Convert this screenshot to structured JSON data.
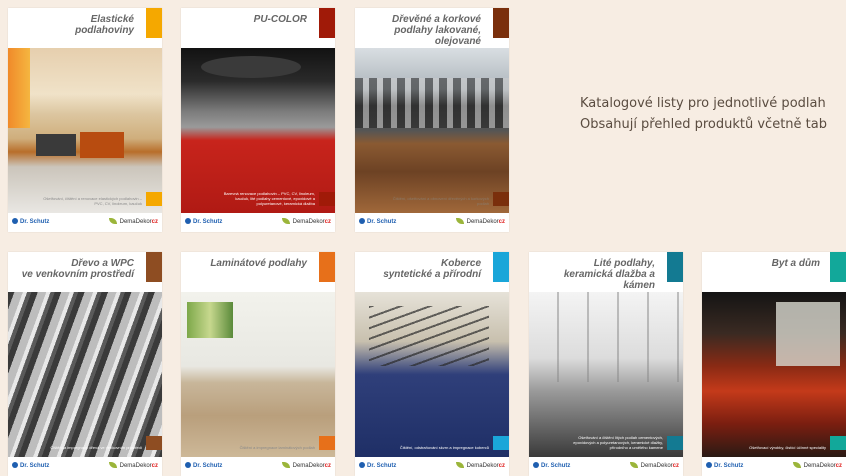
{
  "promo": {
    "line1": "Katalogové listy pro jednotlivé podlah",
    "line2": "Obsahují přehled produktů včetně tab"
  },
  "brand": {
    "left": "Dr. Schutz",
    "right_main": "DemaDekor",
    "right_suffix": "cz"
  },
  "cards": [
    {
      "title": "Elastické\npodlahoviny",
      "accent": "#f5a800",
      "desc": "Ošetřování, čištění a renovace elastických podlahovin – PVC, CV, linoleum, kaučuk",
      "desc_color": "#8a8a8a"
    },
    {
      "title": "PU-COLOR",
      "accent": "#a01a08",
      "desc": "Barevná renovace podlahovin – PVC, CV, linoleum, kaučuk, lité podlahy cementové, epoxidové a polyuretanové, keramická dlažba",
      "desc_color": "#ffffff"
    },
    {
      "title": "Dřevěné a korkové\npodlahy lakované, olejované",
      "accent": "#7a2f0c",
      "desc": "Čištění, ošetřování a obnovení dřevěných a korkových podlah",
      "desc_color": "#8a7a6a"
    },
    {
      "title": "Dřevo a WPC\nve venkovním prostředí",
      "accent": "#8e4d22",
      "desc": "Čištění a impregnace dřeva ve venkovním prostředí",
      "desc_color": "#ffffff"
    },
    {
      "title": "Laminátové podlahy",
      "accent": "#e7701a",
      "desc": "Čištění a impregnace laminátových podlah",
      "desc_color": "#8a8a8a"
    },
    {
      "title": "Koberce\nsyntetické a přírodní",
      "accent": "#1aa6d9",
      "desc": "Čištění, odstraňování skvrn a impregnace koberců",
      "desc_color": "#ffffff"
    },
    {
      "title": "Lité podlahy,\nkeramická dlažba a kámen",
      "accent": "#137a92",
      "desc": "Ošetřování a čištění litých podlah cementových, epoxidových a polyuretanových, keramické dlažby, přírodního a umělého kamene",
      "desc_color": "#ffffff"
    },
    {
      "title": "Byt a dům",
      "accent": "#12a89a",
      "desc": "Ošetřovací výrobky, čistící účinné speciality",
      "desc_color": "#ffffff"
    }
  ]
}
